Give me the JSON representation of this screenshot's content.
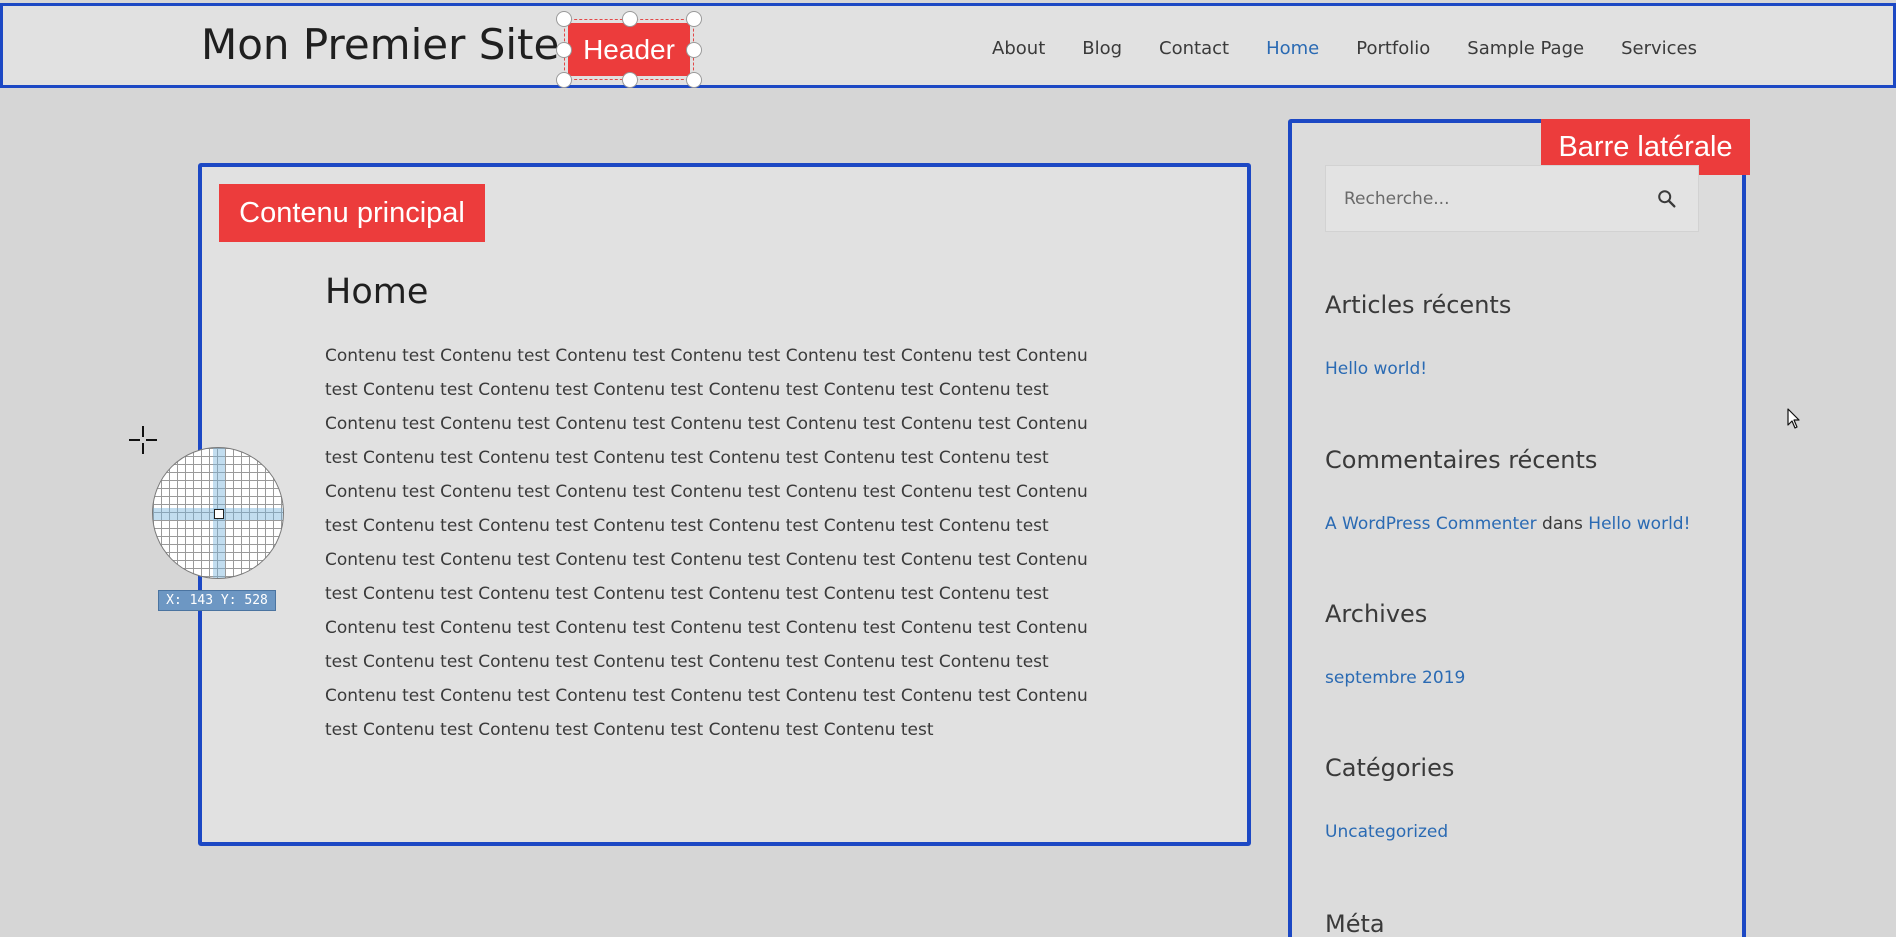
{
  "header": {
    "site_title": "Mon Premier Site",
    "annotation_label": "Header",
    "nav": [
      "About",
      "Blog",
      "Contact",
      "Home",
      "Portfolio",
      "Sample Page",
      "Services"
    ],
    "active_nav": "Home"
  },
  "main": {
    "annotation_label": "Contenu principal",
    "title": "Home",
    "content": "Contenu test Contenu test Contenu test Contenu test Contenu test Contenu test Contenu test Contenu test Contenu test Contenu test Contenu test Contenu test Contenu test Contenu test Contenu test Contenu test Contenu test Contenu test Contenu test Contenu test Contenu test Contenu test Contenu test Contenu test Contenu test Contenu test Contenu test Contenu test Contenu test Contenu test Contenu test Contenu test Contenu test Contenu test Contenu test Contenu test Contenu test Contenu test Contenu test Contenu test Contenu test Contenu test Contenu test Contenu test Contenu test Contenu test Contenu test Contenu test Contenu test Contenu test Contenu test Contenu test Contenu test Contenu test Contenu test Contenu test Contenu test Contenu test Contenu test Contenu test Contenu test Contenu test Contenu test Contenu test Contenu test Contenu test Contenu test Contenu test Contenu test Contenu test Contenu test Contenu test Contenu test Contenu test Contenu test Contenu test Contenu test"
  },
  "sidebar": {
    "annotation_label": "Barre latérale",
    "search_placeholder": "Recherche...",
    "recent_posts": {
      "title": "Articles récents",
      "items": [
        "Hello world!"
      ]
    },
    "recent_comments": {
      "title": "Commentaires récents",
      "author": "A WordPress Commenter",
      "connector": "dans",
      "post": "Hello world!"
    },
    "archives": {
      "title": "Archives",
      "items": [
        "septembre 2019"
      ]
    },
    "categories": {
      "title": "Catégories",
      "items": [
        "Uncategorized"
      ]
    },
    "meta": {
      "title": "Méta"
    }
  },
  "overlay": {
    "coord_readout": "X: 143 Y: 528"
  },
  "icons": {
    "search": "search-icon",
    "crosshair": "crosshair-icon",
    "cursor": "mouse-pointer-icon"
  }
}
